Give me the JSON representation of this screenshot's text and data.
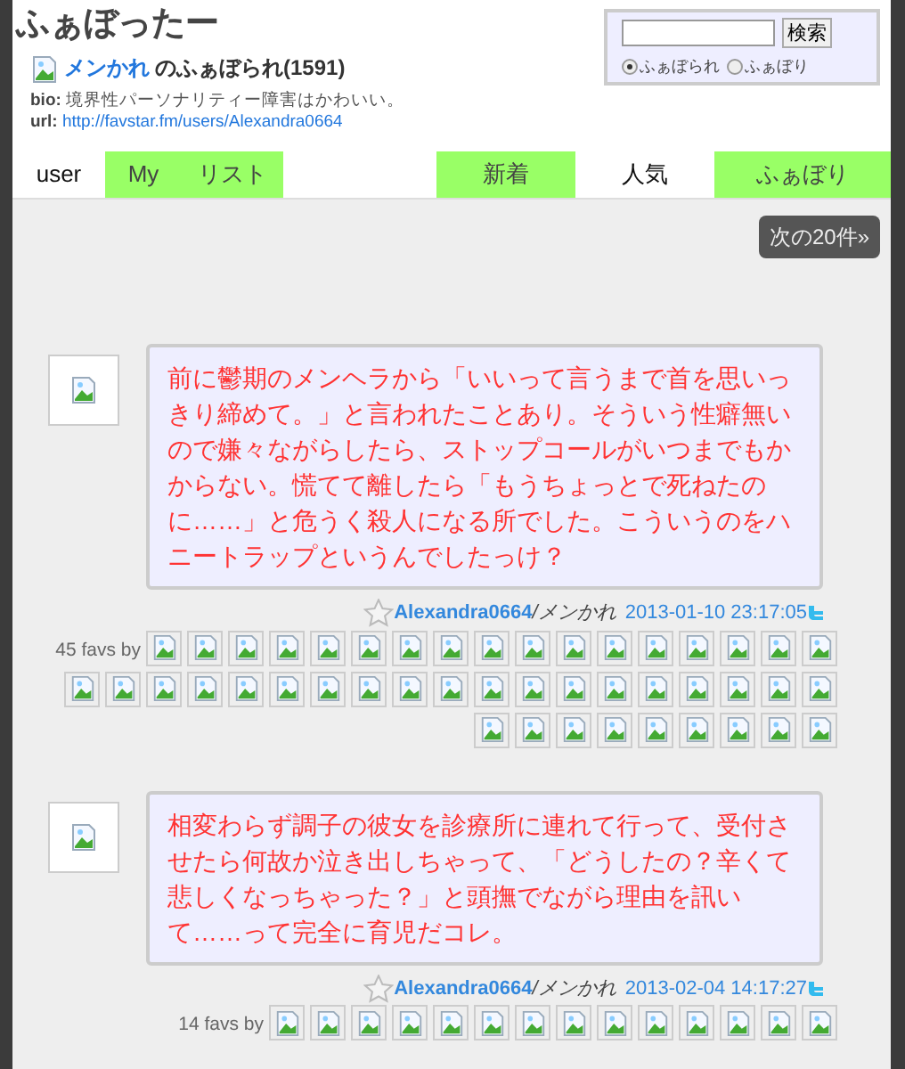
{
  "site_title": "ふぁぼったー",
  "profile": {
    "name": "メンかれ",
    "suffix": "のふぁぼられ(1591)",
    "bio_label": "bio:",
    "bio": "境界性パーソナリティー障害はかわいい。",
    "url_label": "url:",
    "url": "http://favstar.fm/users/Alexandra0664"
  },
  "search": {
    "button": "検索",
    "options": [
      {
        "label": "ふぁぼられ",
        "selected": true
      },
      {
        "label": "ふぁぼり",
        "selected": false
      }
    ]
  },
  "tabs_left": [
    {
      "label": "user",
      "selected": true
    },
    {
      "label": "My",
      "selected": false
    },
    {
      "label": "リスト",
      "selected": false
    }
  ],
  "tabs_right": [
    {
      "label": "新着",
      "selected": false
    },
    {
      "label": "人気",
      "selected": true
    },
    {
      "label": "ふぁぼり",
      "selected": false
    }
  ],
  "next_button": "次の20件»",
  "posts": [
    {
      "text": "前に鬱期のメンヘラから「いいって言うまで首を思いっきり締めて。」と言われたことあり。そういう性癖無いので嫌々ながらしたら、ストップコールがいつまでもかからない。慌てて離したら「もうちょっとで死ねたのに……」と危うく殺人になる所でした。こういうのをハニートラップというんでしたっけ？",
      "screen_name": "Alexandra0664",
      "name_suffix": "/メンかれ",
      "date": "2013-01-10 23:17:05",
      "favs_label": "45 favs by",
      "avatars": [
        {
          "kind": "broken"
        },
        {
          "kind": "broken"
        },
        {
          "kind": "broken"
        },
        {
          "kind": "broken"
        },
        {
          "kind": "broken"
        },
        {
          "kind": "broken"
        },
        {
          "kind": "broken"
        },
        {
          "kind": "broken"
        },
        {
          "kind": "broken"
        },
        {
          "kind": "broken"
        },
        {
          "kind": "broken"
        },
        {
          "kind": "broken"
        },
        {
          "kind": "broken"
        },
        {
          "kind": "broken"
        },
        {
          "kind": "broken"
        },
        {
          "kind": "broken"
        },
        {
          "kind": "broken"
        },
        {
          "kind": "broken"
        },
        {
          "kind": "broken"
        },
        {
          "kind": "broken"
        },
        {
          "kind": "broken"
        },
        {
          "kind": "broken"
        },
        {
          "kind": "broken"
        },
        {
          "kind": "broken"
        },
        {
          "kind": "broken"
        },
        {
          "kind": "broken"
        },
        {
          "kind": "broken"
        },
        {
          "kind": "broken"
        },
        {
          "kind": "broken"
        },
        {
          "kind": "broken"
        },
        {
          "kind": "broken"
        },
        {
          "kind": "broken"
        },
        {
          "kind": "broken"
        },
        {
          "kind": "broken"
        },
        {
          "kind": "broken"
        },
        {
          "kind": "broken"
        },
        {
          "kind": "broken"
        },
        {
          "kind": "broken"
        },
        {
          "kind": "broken"
        },
        {
          "kind": "broken"
        },
        {
          "kind": "broken"
        },
        {
          "kind": "broken"
        },
        {
          "kind": "broken"
        },
        {
          "kind": "broken"
        },
        {
          "kind": "broken"
        }
      ]
    },
    {
      "text": "相変わらず調子の彼女を診療所に連れて行って、受付させたら何故か泣き出しちゃって、「どうしたの？辛くて悲しくなっちゃった？」と頭撫でながら理由を訊いて……って完全に育児だコレ。",
      "screen_name": "Alexandra0664",
      "name_suffix": "/メンかれ",
      "date": "2013-02-04 14:17:27",
      "favs_label": "14 favs by",
      "avatars": [
        {
          "kind": "broken"
        },
        {
          "kind": "broken"
        },
        {
          "kind": "broken"
        },
        {
          "kind": "broken"
        },
        {
          "kind": "broken"
        },
        {
          "kind": "broken"
        },
        {
          "kind": "broken"
        },
        {
          "kind": "broken"
        },
        {
          "kind": "broken"
        },
        {
          "kind": "broken"
        },
        {
          "kind": "broken"
        },
        {
          "kind": "broken"
        },
        {
          "kind": "broken"
        },
        {
          "kind": "broken"
        }
      ]
    }
  ]
}
